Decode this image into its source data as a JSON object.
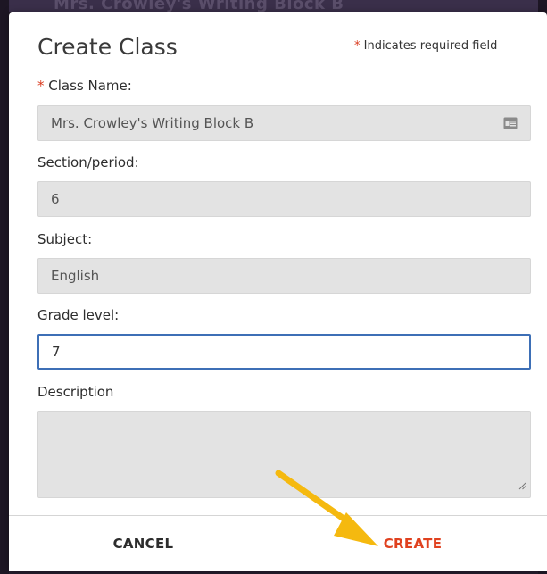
{
  "backdrop": {
    "ghost_title": "Mrs. Crowley's Writing Block B"
  },
  "modal": {
    "title": "Create Class",
    "required_marker": "*",
    "required_note": "Indicates required field"
  },
  "fields": {
    "class_name": {
      "label": "Class Name:",
      "value": "Mrs. Crowley's Writing Block B",
      "required": true,
      "icon": "id-card-icon"
    },
    "section": {
      "label": "Section/period:",
      "value": "6"
    },
    "subject": {
      "label": "Subject:",
      "value": "English"
    },
    "grade": {
      "label": "Grade level:",
      "value": "7"
    },
    "description": {
      "label": "Description",
      "value": ""
    }
  },
  "footer": {
    "cancel_label": "CANCEL",
    "create_label": "CREATE"
  },
  "colors": {
    "accent_red": "#e0411f",
    "focus_blue": "#3d6fb6",
    "arrow_yellow": "#f5b90f"
  }
}
